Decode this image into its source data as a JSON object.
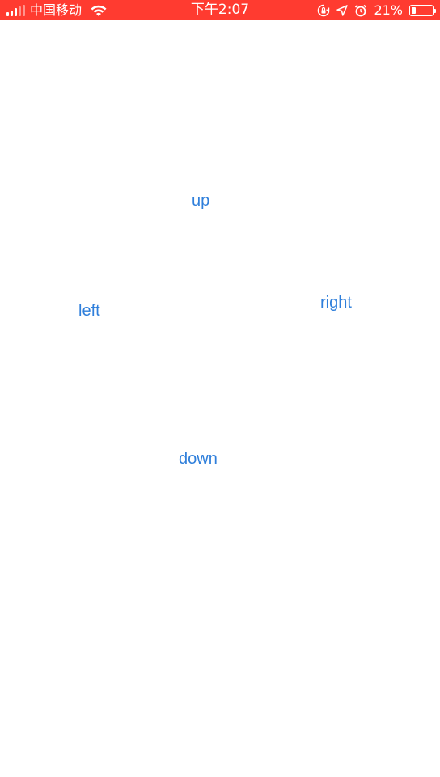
{
  "status_bar": {
    "carrier": "中国移动",
    "time": "下午2:07",
    "battery_percent": "21%",
    "battery_level": 0.21,
    "background_color": "#ff3b30",
    "icons": [
      "signal-icon",
      "wifi-icon",
      "orientation-lock-icon",
      "location-icon",
      "alarm-icon",
      "battery-icon"
    ]
  },
  "controls": {
    "up": "up",
    "left": "left",
    "right": "right",
    "down": "down",
    "accent_color": "#2f7fdb"
  }
}
